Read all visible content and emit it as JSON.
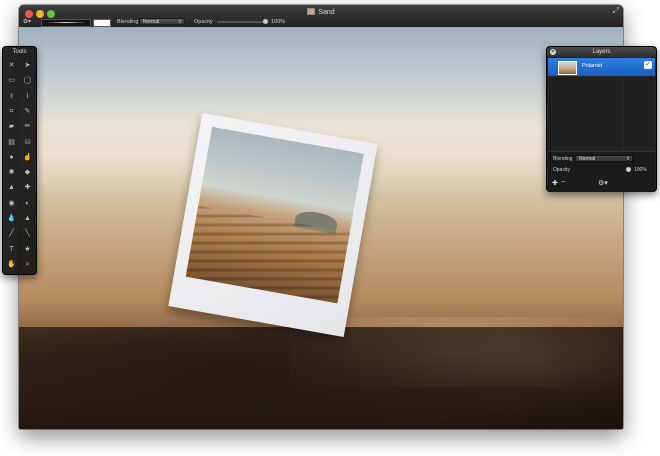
{
  "window": {
    "title": "Sand"
  },
  "toolbar": {
    "blending_label": "Blending",
    "blending_value": "Normal",
    "opacity_label": "Opacity",
    "opacity_value": "100%"
  },
  "tools_panel": {
    "title": "Tools",
    "tools": [
      {
        "icon": "x-icon",
        "glyph": "✕"
      },
      {
        "icon": "pointer-icon",
        "glyph": "➤"
      },
      {
        "icon": "rect-select-icon",
        "glyph": "▭"
      },
      {
        "icon": "ellipse-select-icon",
        "glyph": "◯"
      },
      {
        "icon": "lasso-icon",
        "glyph": "ℓ"
      },
      {
        "icon": "polygon-lasso-icon",
        "glyph": "⌇"
      },
      {
        "icon": "crop-icon",
        "glyph": "⌗"
      },
      {
        "icon": "eyedropper-icon",
        "glyph": "✎"
      },
      {
        "icon": "eraser-icon",
        "glyph": "▰"
      },
      {
        "icon": "pencil-icon",
        "glyph": "✏"
      },
      {
        "icon": "gradient-icon",
        "glyph": "▤"
      },
      {
        "icon": "paint-bucket-icon",
        "glyph": "⛁"
      },
      {
        "icon": "brush-icon",
        "glyph": "●"
      },
      {
        "icon": "smudge-icon",
        "glyph": "☝"
      },
      {
        "icon": "blur-icon",
        "glyph": "✺"
      },
      {
        "icon": "sharpen-icon",
        "glyph": "◆"
      },
      {
        "icon": "stamp-icon",
        "glyph": "▲"
      },
      {
        "icon": "heal-icon",
        "glyph": "✚"
      },
      {
        "icon": "red-eye-icon",
        "glyph": "◉"
      },
      {
        "icon": "dodge-icon",
        "glyph": "◐"
      },
      {
        "icon": "drop-icon",
        "glyph": "💧"
      },
      {
        "icon": "burn-icon",
        "glyph": "▲"
      },
      {
        "icon": "pen-icon",
        "glyph": "╱"
      },
      {
        "icon": "line-icon",
        "glyph": "╲"
      },
      {
        "icon": "text-icon",
        "glyph": "T"
      },
      {
        "icon": "shape-icon",
        "glyph": "★"
      },
      {
        "icon": "hand-icon",
        "glyph": "✋"
      },
      {
        "icon": "zoom-icon",
        "glyph": "⌕"
      }
    ]
  },
  "layers_panel": {
    "title": "Layers",
    "layers": [
      {
        "name": "Polaroid",
        "visible": true
      }
    ],
    "blending_label": "Blending",
    "blending_value": "Normal",
    "opacity_label": "Opacity",
    "opacity_value": "100%"
  }
}
